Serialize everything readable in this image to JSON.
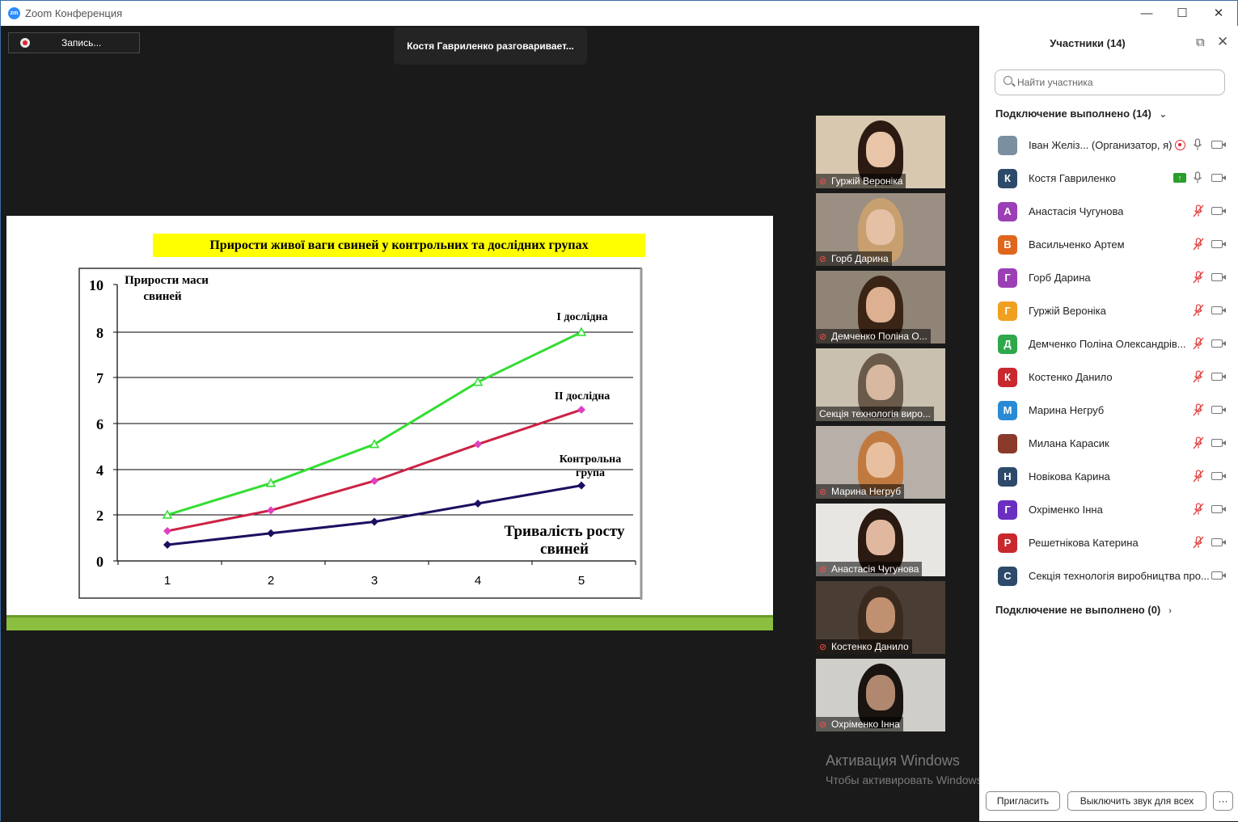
{
  "window": {
    "title": "Zoom Конференция",
    "logo_text": "zm",
    "minimize": "—",
    "maximize": "☐",
    "close": "✕"
  },
  "recording": {
    "label": "Запись..."
  },
  "speaker_banner": "Костя  Гавриленко разговаривает...",
  "slide": {
    "title": "Прирости живої ваги свиней у контрольних та дослідних групах"
  },
  "chart_data": {
    "type": "line",
    "title": "Прирости живої ваги свиней у контрольних та дослідних групах",
    "ylabel": "Прирости маси свиней",
    "xlabel": "Тривалість росту свиней",
    "categories": [
      "1",
      "2",
      "3",
      "4",
      "5"
    ],
    "y_ticks": [
      "0",
      "2",
      "4",
      "6",
      "7",
      "8",
      "10"
    ],
    "grid": true,
    "series": [
      {
        "name": "І дослідна",
        "color": "#33dd33",
        "marker": "triangle",
        "values": [
          2.0,
          3.4,
          5.1,
          6.9,
          8.0
        ]
      },
      {
        "name": "ІІ дослідна",
        "color": "#cc2244",
        "marker_color": "#e040c0",
        "marker": "diamond",
        "values": [
          1.3,
          2.2,
          3.5,
          5.1,
          6.3
        ]
      },
      {
        "name": "Контрольна група",
        "color": "#1a1060",
        "marker": "diamond",
        "values": [
          0.7,
          1.2,
          1.7,
          2.5,
          3.3
        ]
      }
    ]
  },
  "thumbnails": [
    {
      "name": "Гуржій Вероніка",
      "muted": true
    },
    {
      "name": "Горб Дарина",
      "muted": true
    },
    {
      "name": "Демченко Поліна  О...",
      "muted": true
    },
    {
      "name": "Секція технологія виро...",
      "muted": false
    },
    {
      "name": "Марина Негруб",
      "muted": true
    },
    {
      "name": "Анастасія Чугунова",
      "muted": true
    },
    {
      "name": "Костенко Данило",
      "muted": true
    },
    {
      "name": "Охріменко Інна",
      "muted": true
    }
  ],
  "watermark": {
    "line1": "Активация Windows",
    "line2": "Чтобы активировать Windows, перейдите в раздел \"Параметры\"."
  },
  "panel": {
    "title": "Участники (14)",
    "search_placeholder": "Найти участника",
    "connected_header": "Подключение выполнено (14)",
    "not_connected_header": "Подключение не выполнено (0)",
    "participants": [
      {
        "initial": "",
        "name": "Іван Желіз... (Организатор, я)",
        "color": "#7a8fa0",
        "mic": "on",
        "extra": "rec"
      },
      {
        "initial": "К",
        "name": "Костя  Гавриленко",
        "color": "#2e4a6b",
        "mic": "on",
        "extra": "share"
      },
      {
        "initial": "А",
        "name": "Анастасія Чугунова",
        "color": "#9b3fb5",
        "mic": "muted",
        "extra": ""
      },
      {
        "initial": "В",
        "name": "Васильченко Артем",
        "color": "#e0661e",
        "mic": "muted",
        "extra": ""
      },
      {
        "initial": "Г",
        "name": "Горб Дарина",
        "color": "#9b3fb5",
        "mic": "muted",
        "extra": ""
      },
      {
        "initial": "Г",
        "name": "Гуржій Вероніка",
        "color": "#f0a020",
        "mic": "muted",
        "extra": ""
      },
      {
        "initial": "Д",
        "name": "Демченко Поліна  Олександрів...",
        "color": "#2ea84a",
        "mic": "muted",
        "extra": ""
      },
      {
        "initial": "К",
        "name": "Костенко Данило",
        "color": "#c8282e",
        "mic": "muted",
        "extra": ""
      },
      {
        "initial": "М",
        "name": "Марина Негруб",
        "color": "#2a8ad4",
        "mic": "muted",
        "extra": ""
      },
      {
        "initial": "",
        "name": "Милана Карасик",
        "color": "#8a3a2a",
        "mic": "muted",
        "extra": ""
      },
      {
        "initial": "Н",
        "name": "Новікова Карина",
        "color": "#2e4a6b",
        "mic": "muted",
        "extra": ""
      },
      {
        "initial": "Г",
        "name": "Охріменко Інна",
        "color": "#6a2fc0",
        "mic": "muted",
        "extra": ""
      },
      {
        "initial": "Р",
        "name": "Решетнікова Катерина",
        "color": "#c8282e",
        "mic": "muted",
        "extra": ""
      },
      {
        "initial": "С",
        "name": "Секція технологія виробництва про...",
        "color": "#2e4a6b",
        "mic": "none",
        "extra": ""
      }
    ],
    "invite_button": "Пригласить",
    "mute_all_button": "Выключить звук для всех",
    "more_button": "···"
  }
}
